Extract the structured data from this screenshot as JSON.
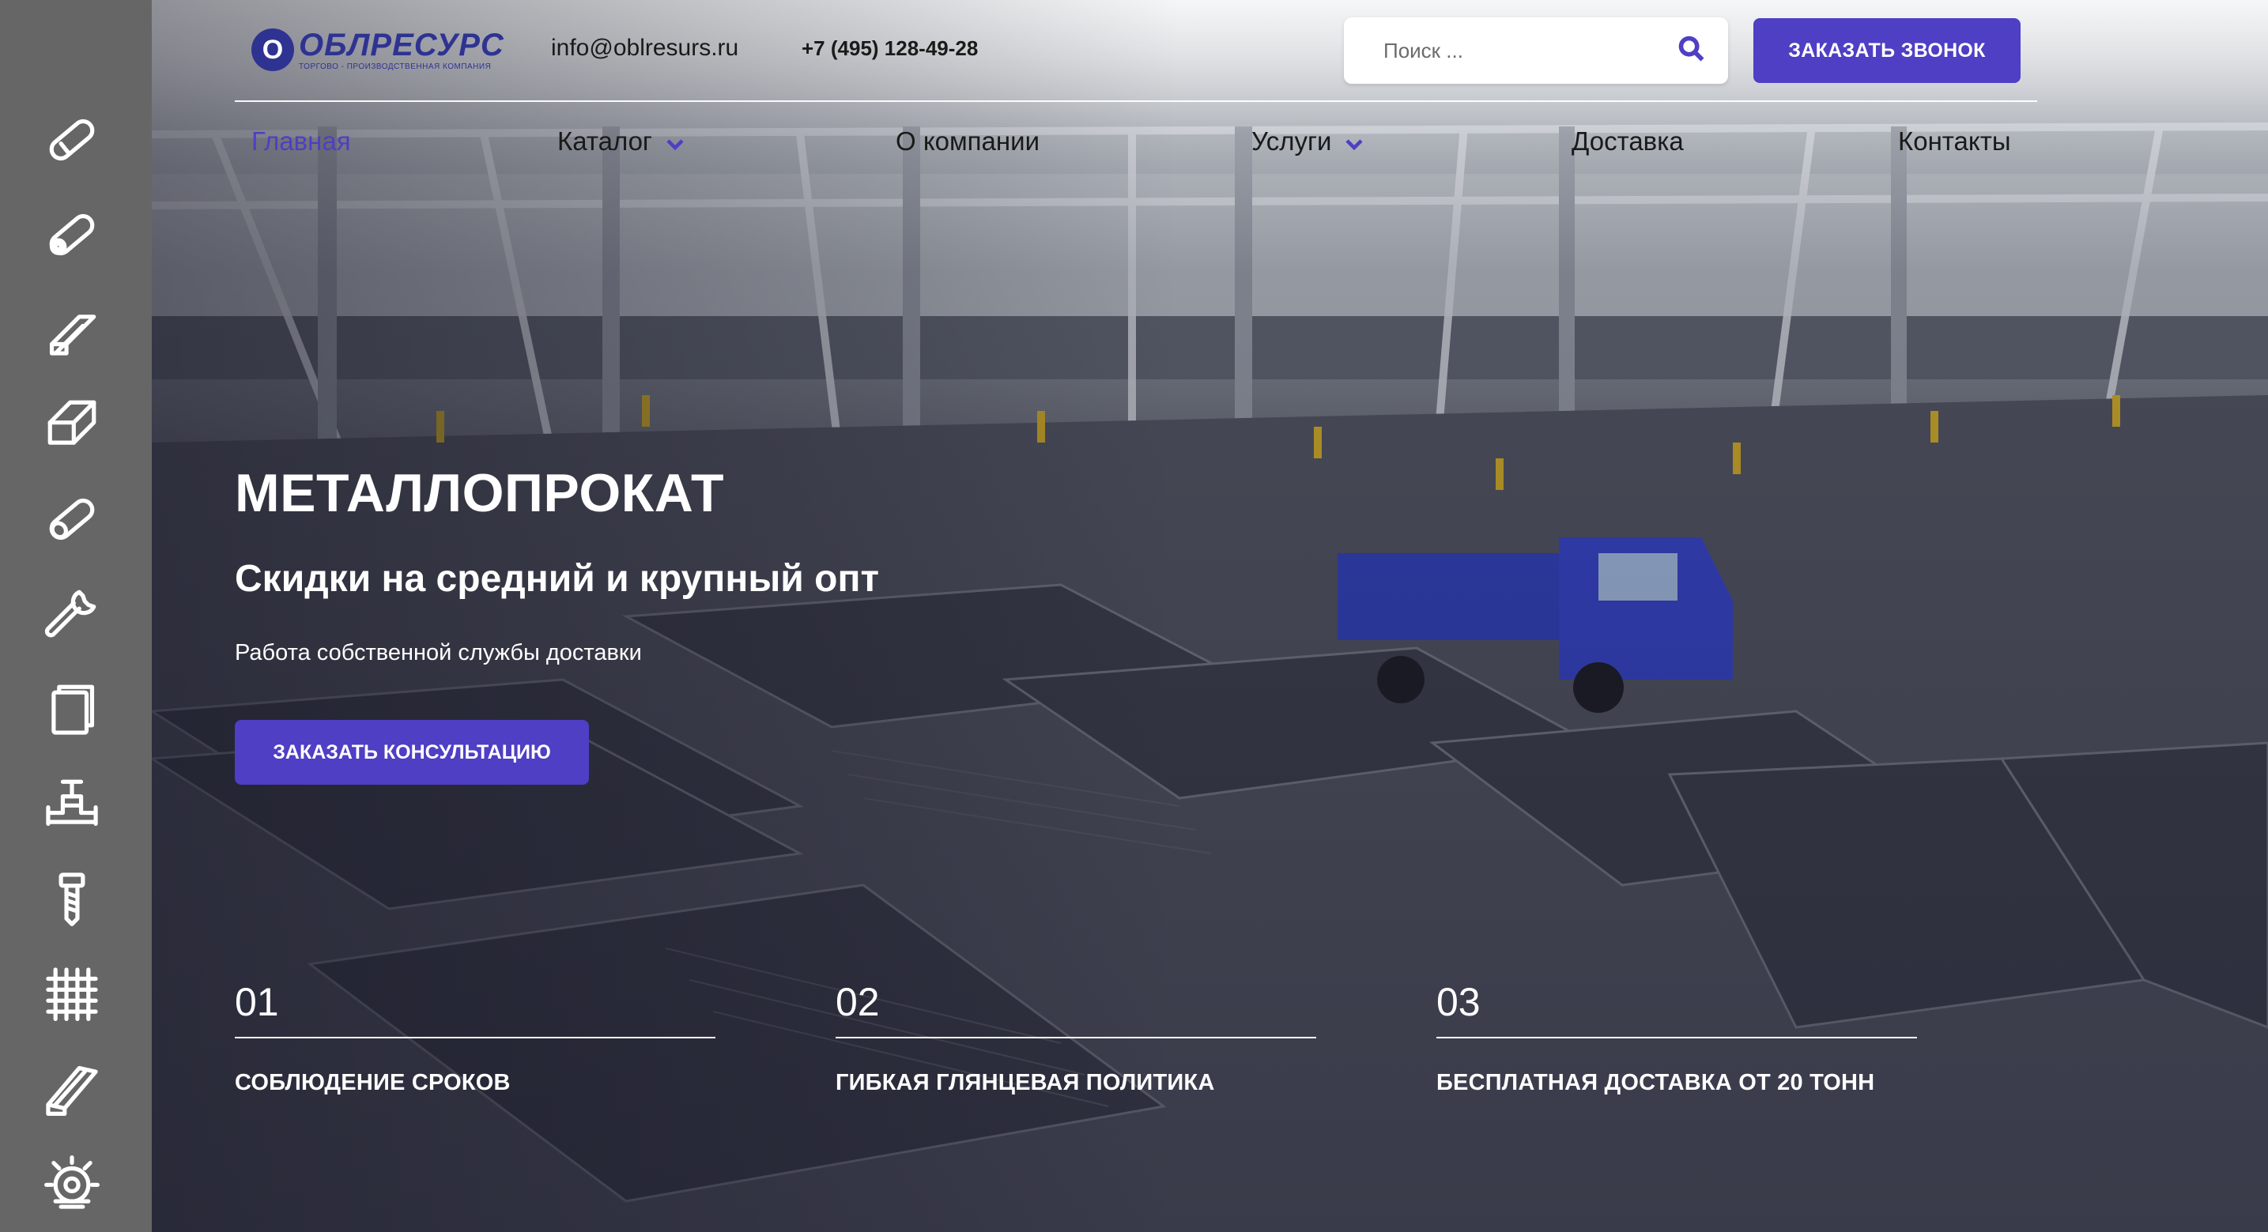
{
  "brand": {
    "name": "ОБЛРЕСУРС",
    "tagline": "ТОРГОВО - ПРОИЗВОДСТВЕННАЯ КОМПАНИЯ",
    "mark": "О",
    "color": "#2e3392"
  },
  "header": {
    "email": "info@oblresurs.ru",
    "phone": "+7 (495) 128-49-28",
    "search_placeholder": "Поиск ...",
    "call_button": "ЗАКАЗАТЬ ЗВОНОК"
  },
  "nav": [
    {
      "label": "Главная",
      "active": true,
      "has_dropdown": false
    },
    {
      "label": "Каталог",
      "active": false,
      "has_dropdown": true
    },
    {
      "label": "О компании",
      "active": false,
      "has_dropdown": false
    },
    {
      "label": "Услуги",
      "active": false,
      "has_dropdown": true
    },
    {
      "label": "Доставка",
      "active": false,
      "has_dropdown": false
    },
    {
      "label": "Контакты",
      "active": false,
      "has_dropdown": false
    }
  ],
  "hero": {
    "title": "МЕТАЛЛОПРОКАТ",
    "subtitle": "Скидки на средний и крупный опт",
    "note": "Работа собственной службы доставки",
    "cta": "ЗАКАЗАТЬ КОНСУЛЬТАЦИЮ"
  },
  "features": [
    {
      "num": "01",
      "text": "СОБЛЮДЕНИЕ СРОКОВ"
    },
    {
      "num": "02",
      "text": "ГИБКАЯ ГЛЯНЦЕВАЯ ПОЛИТИКА"
    },
    {
      "num": "03",
      "text": "БЕСПЛАТНАЯ ДОСТАВКА ОТ 20 ТОНН"
    }
  ],
  "sidebar_icons": [
    "pipe-icon",
    "tube-coil-icon",
    "beam-icon",
    "square-profile-icon",
    "round-bar-icon",
    "wrench-icon",
    "sheet-metal-icon",
    "valve-icon",
    "bolt-icon",
    "mesh-grid-icon",
    "angle-profile-icon",
    "saw-blade-icon"
  ],
  "colors": {
    "accent": "#4e3fc4",
    "sidebar": "#666666",
    "text_dark": "#1a1a1a",
    "white": "#ffffff"
  }
}
